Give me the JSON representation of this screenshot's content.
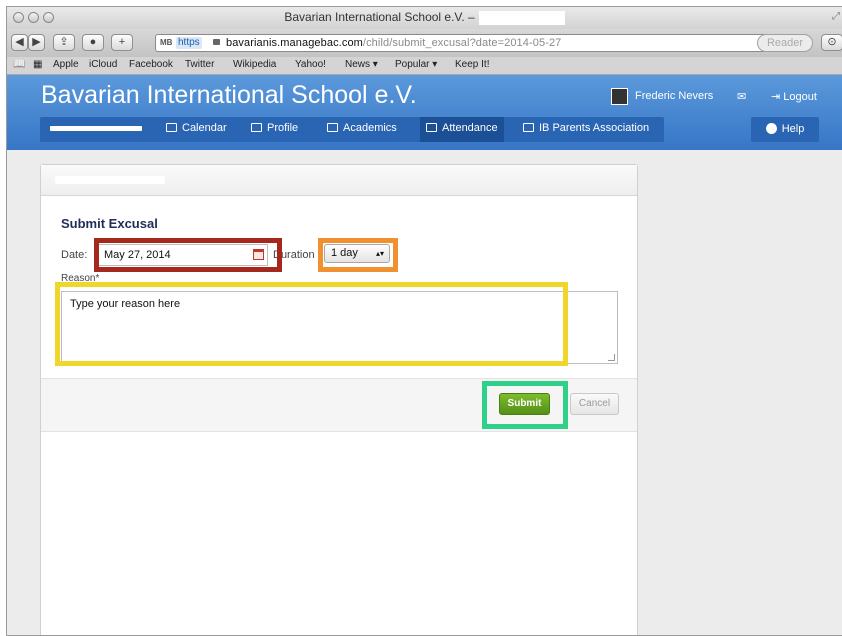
{
  "browser": {
    "window_title": "Bavarian International School e.V. –",
    "url_prefix_badge": "MB",
    "url_scheme": "https",
    "url_domain": "bavarianis.managebac.com",
    "url_path": "/child/submit_excusal?date=2014-05-27",
    "reader_label": "Reader",
    "bookmarks": [
      "Apple",
      "iCloud",
      "Facebook",
      "Twitter",
      "Wikipedia",
      "Yahoo!",
      "News ▾",
      "Popular ▾",
      "Keep It!"
    ]
  },
  "header": {
    "school_name": "Bavarian International School e.V.",
    "user_name": "Frederic Nevers",
    "logout_label": "Logout",
    "help_label": "Help"
  },
  "nav": {
    "items": [
      {
        "label": "Calendar",
        "icon": "calendar-icon"
      },
      {
        "label": "Profile",
        "icon": "profile-card-icon"
      },
      {
        "label": "Academics",
        "icon": "book-icon"
      },
      {
        "label": "Attendance",
        "icon": "checkbox-icon",
        "active": true
      },
      {
        "label": "IB Parents Association",
        "icon": "home-icon"
      }
    ]
  },
  "form": {
    "title": "Submit Excusal",
    "date_label": "Date:",
    "date_value": "May 27, 2014",
    "duration_label": "Duration",
    "duration_value": "1 day",
    "reason_label": "Reason*",
    "reason_value": "Type your reason here",
    "submit_label": "Submit",
    "cancel_label": "Cancel"
  },
  "highlight_colors": {
    "date": "#a5281c",
    "duration": "#f0902e",
    "reason": "#f1d62a",
    "submit": "#2ed08a"
  }
}
